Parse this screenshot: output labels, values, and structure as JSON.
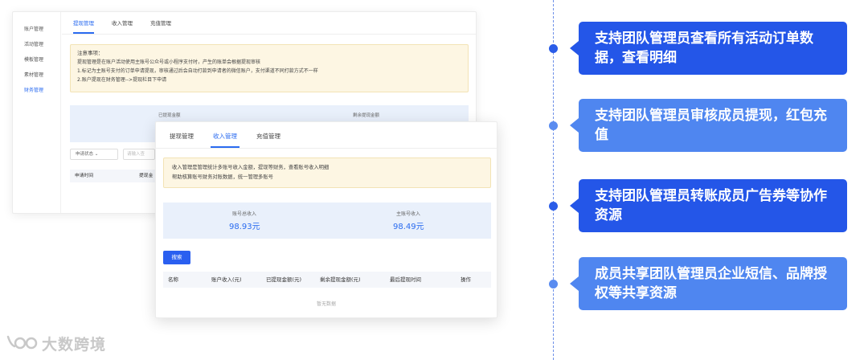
{
  "back_window": {
    "sidebar": [
      "账户管理",
      "活动管理",
      "模板管理",
      "素材管理",
      "财务管理"
    ],
    "tabs": [
      "提现管理",
      "收入管理",
      "充值管理"
    ],
    "notice": {
      "title": "注意事项：",
      "lines": [
        "提现管理是在账户活动使用主账号公众号或小程序支付时，产生的账单会根据提现审核",
        "1.标记为主账号支付的订单申请提现，审核通过后会自动打款到申请者的微信账户，支付渠道不同打款方式不一样",
        "2.账户提现在财务管理-->提现栏目下申请"
      ]
    },
    "stats": [
      "已提现金额",
      "剩余提现金额"
    ],
    "filter": {
      "status": "申请状态",
      "input_placeholder": "请输入查"
    },
    "table_headers": [
      "申请时间",
      "提现金"
    ]
  },
  "front_window": {
    "tabs": [
      "提现管理",
      "收入管理",
      "充值管理"
    ],
    "notice": [
      "收入管理是管理统计多账号收入金额，提现等财务，查看账号收入明细",
      "帮助核算账号财务对账数据，统一管理多账号"
    ],
    "stats": [
      {
        "label": "账号总收入",
        "value": "98.93元"
      },
      {
        "label": "主账号收入",
        "value": "98.49元"
      }
    ],
    "search_label": "搜索",
    "table_headers": [
      "名称",
      "账户收入(元)",
      "已提现金额(元)",
      "剩余提现金额(元)",
      "最后提现时间",
      "操作"
    ],
    "empty_text": "暂无数据"
  },
  "logo": {
    "text": "大数跨境"
  },
  "features": [
    "支持团队管理员查看所有活动订单数据，查看明细",
    "支持团队管理员审核成员提现，红包充值",
    "支持团队管理员转账成员广告券等协作资源",
    "成员共享团队管理员企业短信、品牌授权等共享资源"
  ],
  "colors": {
    "card_dark": "#2456e8",
    "card_light": "#4f86f0",
    "accent_blue": "#2a6bf0",
    "notice_bg": "#fdf6e3"
  }
}
